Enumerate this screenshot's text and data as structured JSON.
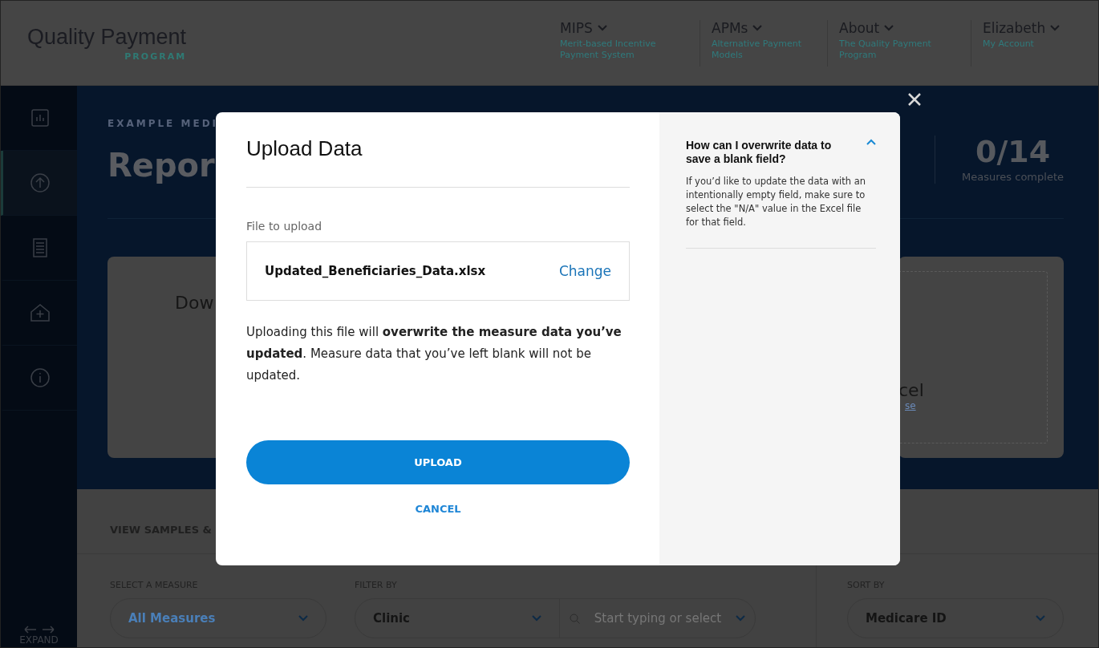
{
  "header": {
    "logo": {
      "title": "Quality Payment",
      "subtitle": "PROGRAM"
    },
    "nav": [
      {
        "label": "MIPS",
        "sublabel": "Merit-based Incentive Payment System"
      },
      {
        "label": "APMs",
        "sublabel": "Alternative Payment Models"
      },
      {
        "label": "About",
        "sublabel": "The Quality Payment Program"
      },
      {
        "label": "Elizabeth",
        "sublabel": "My Account"
      }
    ]
  },
  "sidebar": {
    "items": [
      {
        "kind": "chart",
        "selected": false
      },
      {
        "kind": "upload",
        "selected": true
      },
      {
        "kind": "document",
        "selected": false
      },
      {
        "kind": "clinic",
        "selected": false
      },
      {
        "kind": "info",
        "selected": false
      }
    ],
    "expand_label": "EXPAND"
  },
  "hero": {
    "eyebrow": "EXAMPLE MEDI",
    "title": "Repor",
    "stat": {
      "value": "0/14",
      "label": "Measures complete"
    },
    "download_card": {
      "title": "Dow"
    },
    "upload_card": {
      "title": "cel",
      "link": "se"
    }
  },
  "samples": {
    "heading": "VIEW SAMPLES &",
    "filters": [
      {
        "label": "SELECT A MEASURE",
        "value": "All Measures",
        "kind": "select"
      },
      {
        "label": "FILTER BY",
        "value": "Clinic",
        "kind": "select_search",
        "placeholder": "Start typing or select"
      },
      {
        "label": "SORT BY",
        "value": "Medicare ID",
        "kind": "sort"
      }
    ]
  },
  "modal": {
    "title": "Upload Data",
    "file_label": "File to upload",
    "file_name": "Updated_Beneficiaries_Data.xlsx",
    "change": "Change",
    "message": "Uploading this file will **overwrite the measure data you’ve updated**. Measure data that you’ve left blank will not be updated.",
    "upload": "UPLOAD",
    "cancel": "CANCEL",
    "help": {
      "question": "How can I overwrite data to save a blank field?",
      "expanded": true,
      "answer": "If you’d like to update the data with an intentionally empty field, make sure to select the \"N/A\" value in the Excel file for that field."
    }
  }
}
